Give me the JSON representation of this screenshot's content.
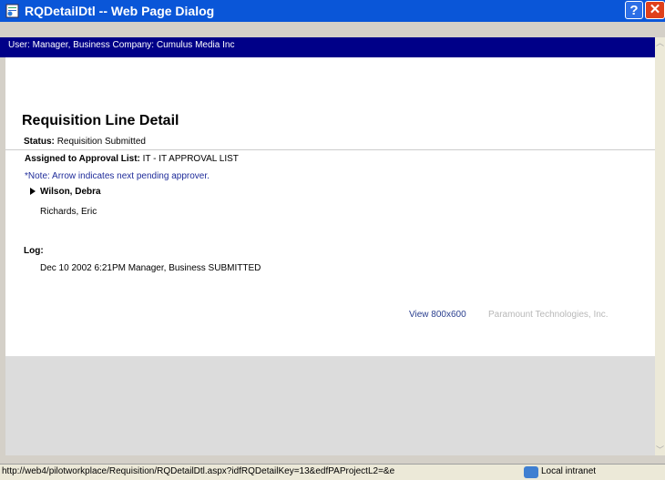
{
  "window": {
    "title": "RQDetailDtl -- Web Page Dialog",
    "help_button": "?",
    "close_button": "✕"
  },
  "userbar": {
    "text": "User: Manager, Business   Company: Cumulus Media Inc"
  },
  "detail": {
    "heading": "Requisition Line Detail",
    "status_label": "Status:",
    "status_value": "Requisition Submitted",
    "approval_label": "Assigned to Approval List:",
    "approval_value": "IT - IT APPROVAL LIST",
    "note": "*Note: Arrow indicates next pending approver.",
    "approvers": [
      "Wilson, Debra",
      "Richards, Eric"
    ],
    "log_label": "Log:",
    "log_entry": "Dec 10 2002 6:21PM Manager, Business SUBMITTED"
  },
  "footer": {
    "view_link": "View 800x600",
    "company": "Paramount Technologies, Inc."
  },
  "statusbar": {
    "url": "http://web4/pilotworkplace/Requisition/RQDetailDtl.aspx?idfRQDetailKey=13&edfPAProjectL2=&e",
    "zone": "Local intranet"
  },
  "colors": {
    "titlebar": "#0a56d8",
    "userbar": "#000088",
    "note": "#1f2c9a",
    "link": "#2a3f8f",
    "footer_bg": "#dcdcdc"
  }
}
